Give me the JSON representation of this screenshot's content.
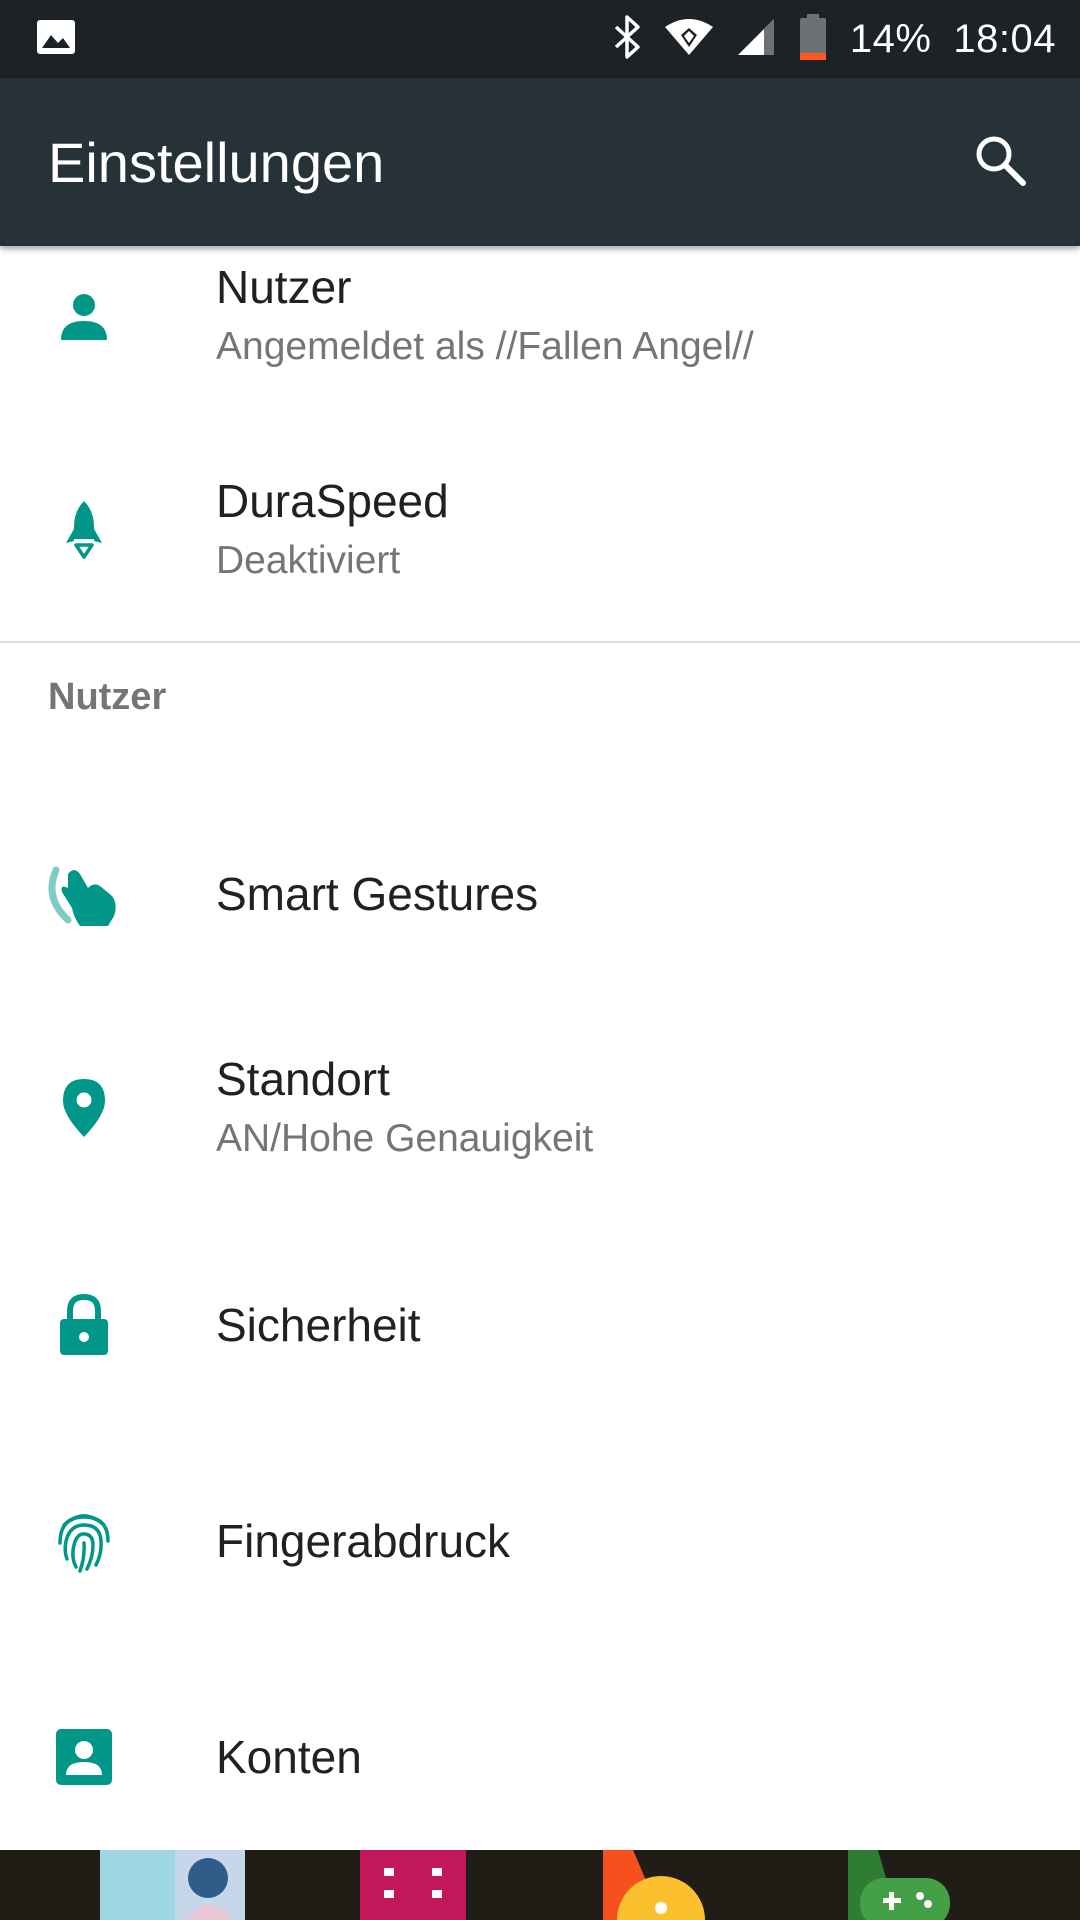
{
  "status_bar": {
    "battery_percent": "14%",
    "time": "18:04",
    "icons": [
      "image-icon",
      "bluetooth-icon",
      "wifi-icon",
      "signal-icon",
      "battery-icon"
    ]
  },
  "app_bar": {
    "title": "Einstellungen",
    "search_icon": "search-icon"
  },
  "list": {
    "items": [
      {
        "icon": "person-icon",
        "title": "Nutzer",
        "subtitle": "Angemeldet als //Fallen Angel//"
      },
      {
        "icon": "rocket-icon",
        "title": "DuraSpeed",
        "subtitle": "Deaktiviert"
      }
    ],
    "section_header": "Nutzer",
    "section_items": [
      {
        "icon": "gesture-icon",
        "title": "Smart Gestures"
      },
      {
        "icon": "location-icon",
        "title": "Standort",
        "subtitle": "AN/Hohe Genauigkeit"
      },
      {
        "icon": "lock-icon",
        "title": "Sicherheit"
      },
      {
        "icon": "fingerprint-icon",
        "title": "Fingerabdruck"
      },
      {
        "icon": "account-icon",
        "title": "Konten"
      }
    ]
  },
  "colors": {
    "accent": "#009688",
    "app_bar": "#263238",
    "status_bar": "#1c2226",
    "battery_low": "#ff5722"
  }
}
